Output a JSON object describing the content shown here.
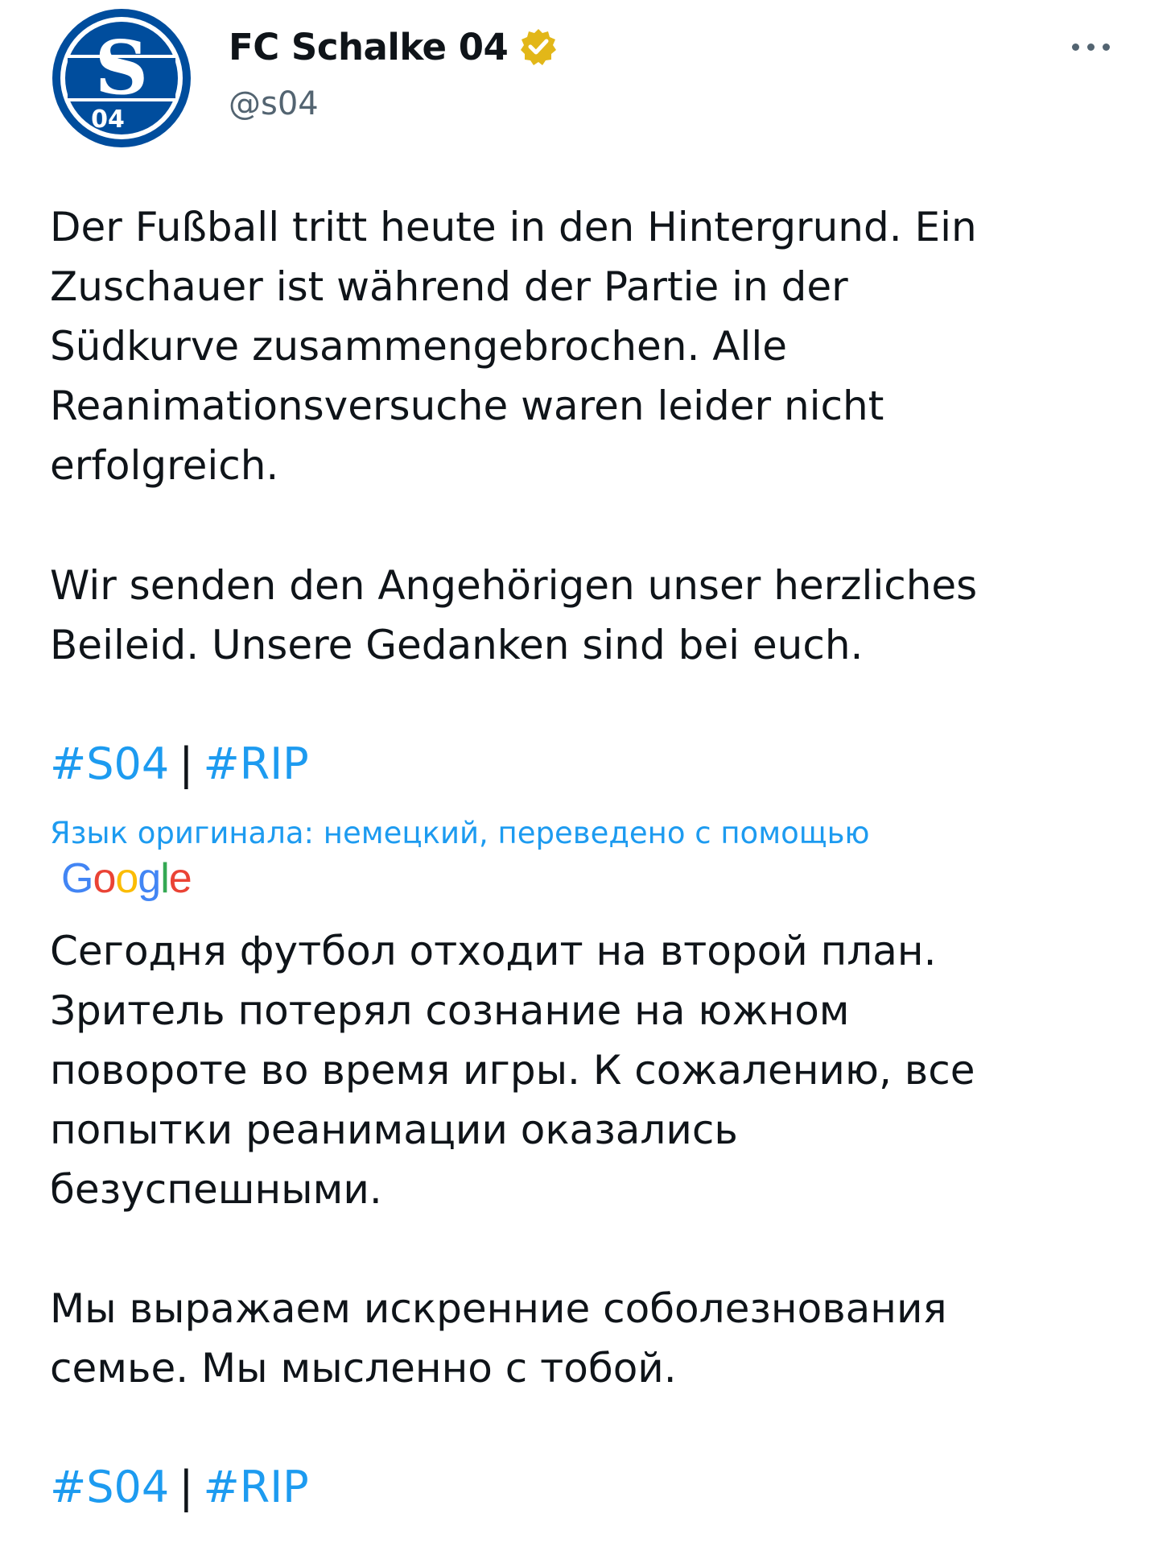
{
  "account": {
    "display_name": "FC Schalke 04",
    "handle": "@s04",
    "avatar_text": "S04",
    "verified_color": "#e2b719"
  },
  "menu": {
    "more_icon": "more-horizontal-icon"
  },
  "original_text": {
    "paragraph1_lines": [
      "Der Fußball tritt heute in den Hintergrund. Ein",
      "Zuschauer ist während der Partie in der",
      "Südkurve zusammengebrochen. Alle",
      "Reanimationsversuche waren leider nicht",
      "erfolgreich."
    ],
    "paragraph2_lines": [
      "Wir senden den Angehörigen unser herzliches",
      "Beileid. Unsere Gedanken sind bei euch."
    ],
    "hashtags": [
      "#S04",
      "#RIP"
    ],
    "separator": "|"
  },
  "translation": {
    "note": "Язык оригинала: немецкий, переведено с помощью",
    "provider": "Google",
    "paragraph1_lines": [
      "Сегодня футбол отходит на второй план.",
      "Зритель потерял сознание на южном",
      "повороте во время игры. К сожалению, все",
      "попытки реанимации оказались",
      "безуспешными."
    ],
    "paragraph2_lines": [
      "Мы выражаем искренние соболезнования",
      "семье. Мы мысленно с тобой."
    ],
    "hashtags": [
      "#S04",
      "#RIP"
    ],
    "separator": "|"
  },
  "colors": {
    "link": "#1d9bf0",
    "text": "#0f1419",
    "secondary": "#536471",
    "schalke_blue": "#004d9d"
  }
}
